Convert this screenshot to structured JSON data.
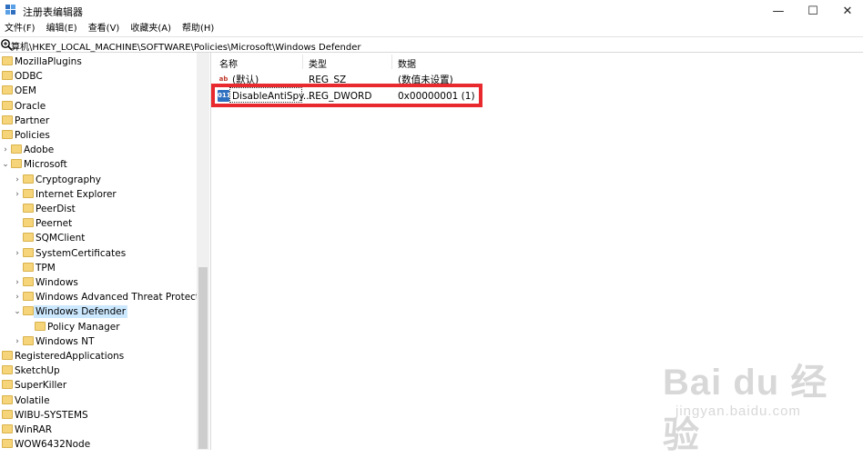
{
  "window": {
    "title": "注册表编辑器",
    "controls": {
      "minimize": "—",
      "maximize": "☐",
      "close": "✕"
    }
  },
  "menubar": [
    {
      "label": "文件(F)"
    },
    {
      "label": "编辑(E)"
    },
    {
      "label": "查看(V)"
    },
    {
      "label": "收藏夹(A)"
    },
    {
      "label": "帮助(H)"
    }
  ],
  "address": {
    "path": "算机\\HKEY_LOCAL_MACHINE\\SOFTWARE\\Policies\\Microsoft\\Windows Defender"
  },
  "tree": [
    {
      "label": "MozillaPlugins",
      "level": 0,
      "arrow": ""
    },
    {
      "label": "ODBC",
      "level": 0,
      "arrow": ""
    },
    {
      "label": "OEM",
      "level": 0,
      "arrow": ""
    },
    {
      "label": "Oracle",
      "level": 0,
      "arrow": ""
    },
    {
      "label": "Partner",
      "level": 0,
      "arrow": ""
    },
    {
      "label": "Policies",
      "level": 0,
      "arrow": ""
    },
    {
      "label": "Adobe",
      "level": 1,
      "arrow": "›"
    },
    {
      "label": "Microsoft",
      "level": 1,
      "arrow": "⌄"
    },
    {
      "label": "Cryptography",
      "level": 2,
      "arrow": "›"
    },
    {
      "label": "Internet Explorer",
      "level": 2,
      "arrow": "›"
    },
    {
      "label": "PeerDist",
      "level": 2,
      "arrow": ""
    },
    {
      "label": "Peernet",
      "level": 2,
      "arrow": ""
    },
    {
      "label": "SQMClient",
      "level": 2,
      "arrow": ""
    },
    {
      "label": "SystemCertificates",
      "level": 2,
      "arrow": "›"
    },
    {
      "label": "TPM",
      "level": 2,
      "arrow": ""
    },
    {
      "label": "Windows",
      "level": 2,
      "arrow": "›"
    },
    {
      "label": "Windows Advanced Threat Protection",
      "level": 2,
      "arrow": "›"
    },
    {
      "label": "Windows Defender",
      "level": 2,
      "arrow": "⌄",
      "selected": true
    },
    {
      "label": "Policy Manager",
      "level": 3,
      "arrow": ""
    },
    {
      "label": "Windows NT",
      "level": 2,
      "arrow": "›"
    },
    {
      "label": "RegisteredApplications",
      "level": 0,
      "arrow": ""
    },
    {
      "label": "SketchUp",
      "level": 0,
      "arrow": ""
    },
    {
      "label": "SuperKiller",
      "level": 0,
      "arrow": ""
    },
    {
      "label": "Volatile",
      "level": 0,
      "arrow": ""
    },
    {
      "label": "WIBU-SYSTEMS",
      "level": 0,
      "arrow": ""
    },
    {
      "label": "WinRAR",
      "level": 0,
      "arrow": ""
    },
    {
      "label": "WOW6432Node",
      "level": 0,
      "arrow": ""
    }
  ],
  "list": {
    "headers": {
      "name": "名称",
      "type": "类型",
      "data": "数据"
    },
    "rows": [
      {
        "icon": "ab",
        "name": "(默认)",
        "type": "REG_SZ",
        "data": "(数值未设置)"
      },
      {
        "icon": "011",
        "name": "DisableAntiSpy...",
        "type": "REG_DWORD",
        "data": "0x00000001 (1)"
      }
    ]
  },
  "watermark": {
    "main": "Bai du 经验",
    "sub": "jingyan.baidu.com"
  },
  "colors": {
    "highlight": "#e8292e",
    "selection": "#cce8ff",
    "folder": "#f6d57a"
  }
}
